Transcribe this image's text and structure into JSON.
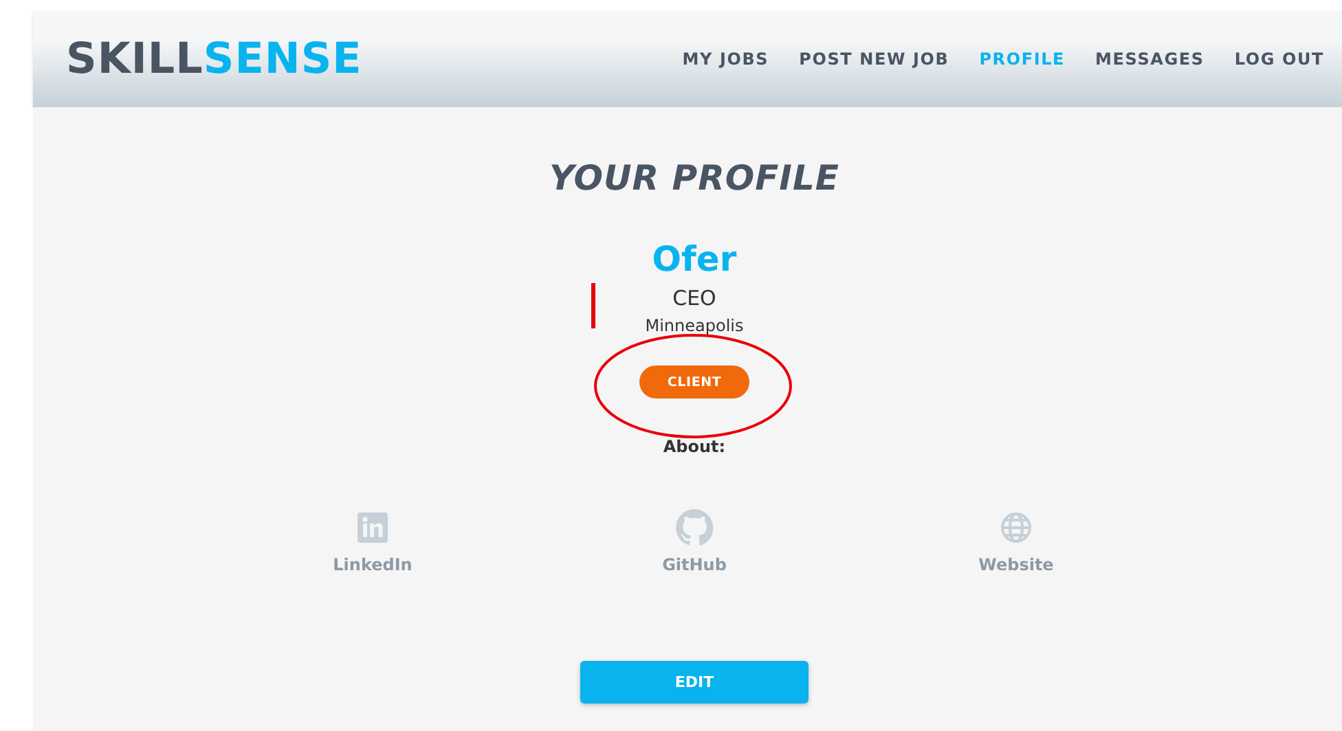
{
  "header": {
    "logo": [
      "SKILL",
      "SENSE"
    ],
    "nav": [
      {
        "label": "MY JOBS",
        "selected": false
      },
      {
        "label": "POST NEW JOB",
        "selected": false
      },
      {
        "label": "PROFILE",
        "selected": true
      },
      {
        "label": "MESSAGES",
        "selected": false
      },
      {
        "label": "LOG OUT",
        "selected": false
      }
    ]
  },
  "page_title": "YOUR PROFILE",
  "profile": {
    "name": "Ofer",
    "title": "CEO",
    "location": "Minneapolis",
    "role_badge": "CLIENT",
    "about_label": "About:"
  },
  "links": [
    {
      "kind": "linkedin",
      "label": "LinkedIn"
    },
    {
      "kind": "github",
      "label": "GitHub"
    },
    {
      "kind": "globe",
      "label": "Website"
    }
  ],
  "edit_button": "EDIT",
  "annotations": [
    {
      "kind": "bar"
    },
    {
      "kind": "ellipse"
    }
  ]
}
